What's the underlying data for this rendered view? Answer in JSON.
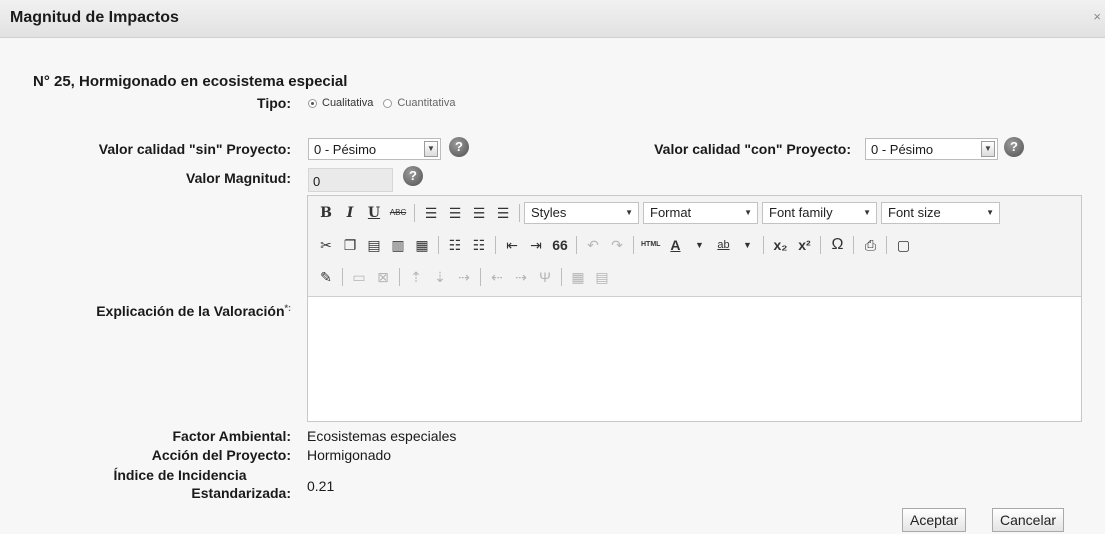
{
  "dialog": {
    "title": "Magnitud de Impactos",
    "close": "×"
  },
  "heading": "N° 25, Hormigonado en ecosistema especial",
  "tipo": {
    "label": "Tipo:",
    "options": [
      "Cualitativa",
      "Cuantitativa"
    ],
    "selected": "Cualitativa"
  },
  "calidad_sin": {
    "label": "Valor calidad \"sin\" Proyecto:",
    "value": "0 - Pésimo"
  },
  "calidad_con": {
    "label": "Valor calidad \"con\" Proyecto:",
    "value": "0 - Pésimo"
  },
  "magnitud": {
    "label": "Valor Magnitud:",
    "value": "0"
  },
  "help_glyph": "?",
  "editor": {
    "label": "Explicación de la Valoración",
    "required_mark": "*:",
    "dropdowns": {
      "styles": "Styles",
      "format": "Format",
      "font_family": "Font family",
      "font_size": "Font size"
    },
    "glyphs": {
      "bold": "B",
      "italic": "I",
      "underline": "U",
      "strike": "ABC",
      "quote": "66",
      "html": "HTML",
      "font_color": "A",
      "highlight": "ab",
      "subscript": "x₂",
      "superscript": "x²",
      "omega": "Ω"
    },
    "content": ""
  },
  "info": {
    "factor_label": "Factor Ambiental:",
    "factor_value": "Ecosistemas especiales",
    "accion_label": "Acción del Proyecto:",
    "accion_value": "Hormigonado",
    "indice_label_1": "Índice de Incidencia",
    "indice_label_2": "Estandarizada:",
    "indice_value": "0.21"
  },
  "buttons": {
    "accept": "Aceptar",
    "cancel": "Cancelar"
  }
}
